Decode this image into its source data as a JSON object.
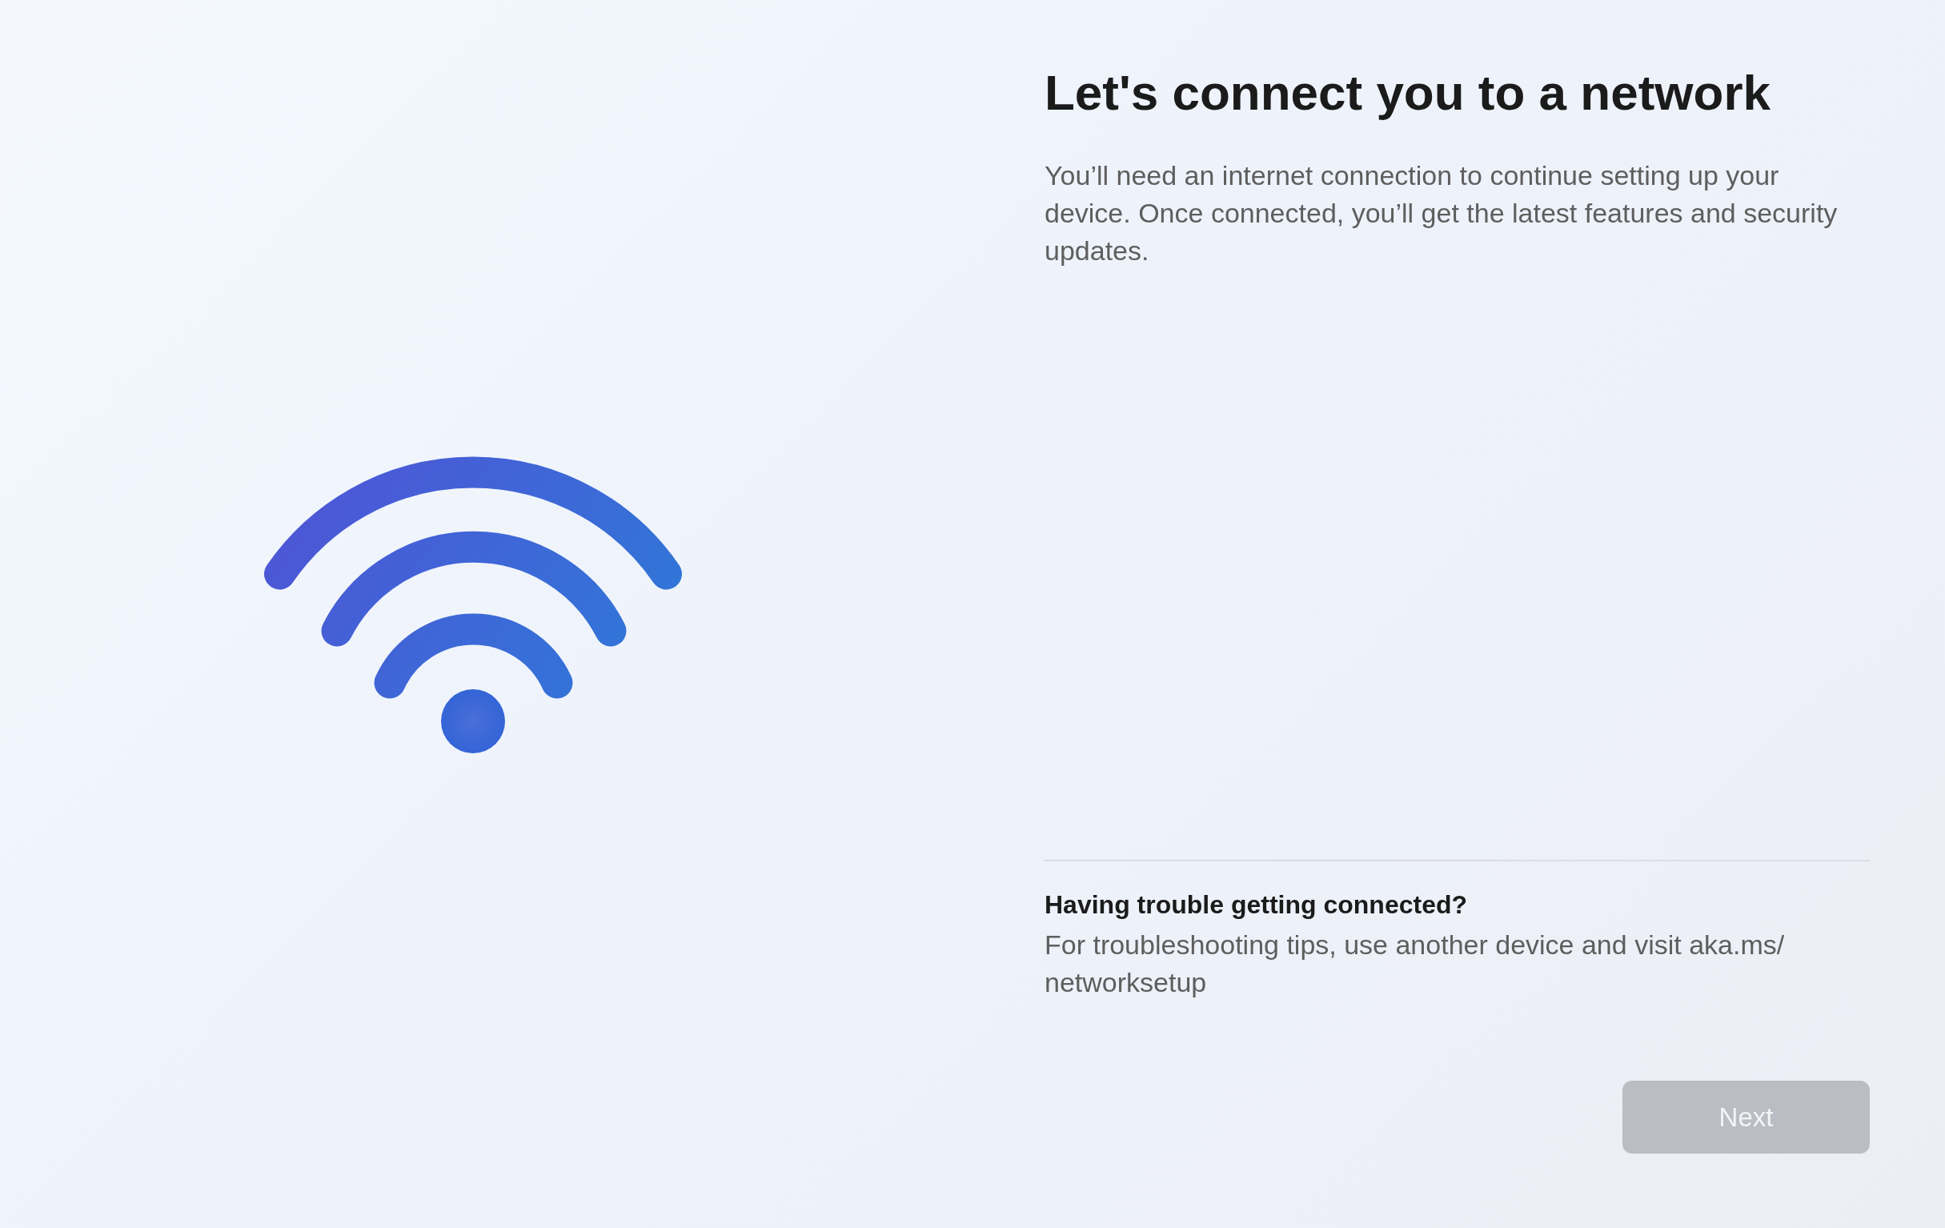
{
  "title": "Let's connect you to a network",
  "description": "You’ll need an internet connection to continue setting up your device. Once connected, you’ll get the latest features and security updates.",
  "help": {
    "heading": "Having trouble getting connected?",
    "text": "For troubleshooting tips, use another device and visit aka.ms/networksetup"
  },
  "buttons": [
    {
      "label": "Next",
      "disabled": true
    }
  ]
}
